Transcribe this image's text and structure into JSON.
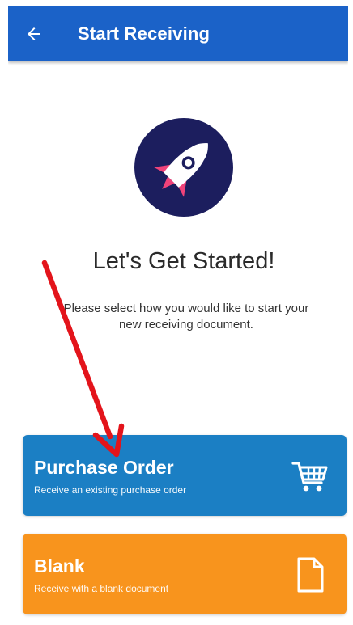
{
  "app_bar": {
    "title": "Start Receiving",
    "back_icon": "arrow-left-icon",
    "color": "#1b62c8"
  },
  "hero": {
    "icon": "rocket-icon",
    "circle_color": "#1c1e5e",
    "heading": "Let's Get Started!",
    "subtext": "Please select how you would like to start your new receiving document."
  },
  "options": [
    {
      "title": "Purchase Order",
      "subtitle": "Receive an existing purchase order",
      "icon": "shopping-cart-icon",
      "color": "#1b7fc4"
    },
    {
      "title": "Blank",
      "subtitle": "Receive with a blank document",
      "icon": "document-icon",
      "color": "#f8941d"
    }
  ],
  "annotation": {
    "icon": "red-arrow-annotation",
    "color": "#e3141b"
  }
}
